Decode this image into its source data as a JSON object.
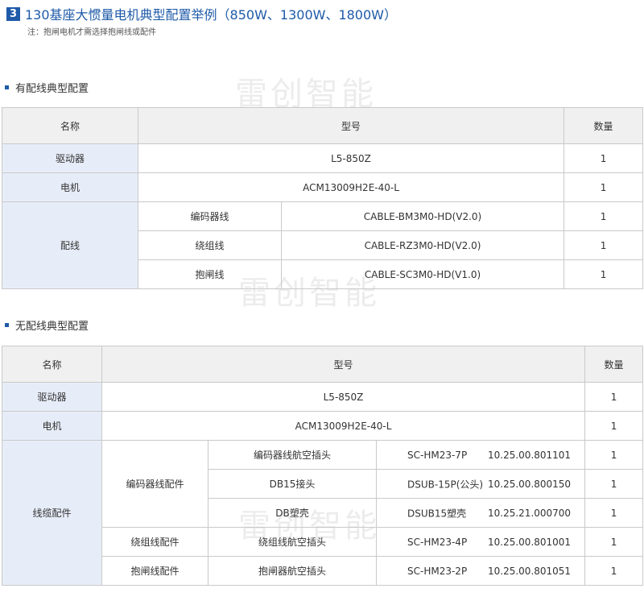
{
  "header": {
    "section_number": "3",
    "title": "130基座大惯量电机典型配置举例（850W、1300W、1800W）",
    "note": "注：抱闸电机才需选择抱闸线或配件"
  },
  "watermark": "雷创智能",
  "colors": {
    "accent": "#1e5aa8",
    "label_bg": "#e7edf8",
    "header_bg": "#f0f0f0",
    "border": "#c9c9c9"
  },
  "icons": {
    "section_marker": "square-bullet-icon"
  },
  "table1": {
    "heading": "有配线典型配置",
    "columns": {
      "name": "名称",
      "model": "型号",
      "qty": "数量"
    },
    "rows": {
      "driver": {
        "name": "驱动器",
        "model": "L5-850Z",
        "qty": "1"
      },
      "motor": {
        "name": "电机",
        "model": "ACM13009H2E-40-L",
        "qty": "1"
      }
    },
    "cables": {
      "label": "配线",
      "items": [
        {
          "name": "编码器线",
          "model": "CABLE-BM3M0-HD(V2.0)",
          "qty": "1"
        },
        {
          "name": "绕组线",
          "model": "CABLE-RZ3M0-HD(V2.0)",
          "qty": "1"
        },
        {
          "name": "抱闸线",
          "model": "CABLE-SC3M0-HD(V1.0)",
          "qty": "1"
        }
      ]
    }
  },
  "table2": {
    "heading": "无配线典型配置",
    "columns": {
      "name": "名称",
      "model": "型号",
      "qty": "数量"
    },
    "rows": {
      "driver": {
        "name": "驱动器",
        "model": "L5-850Z",
        "qty": "1"
      },
      "motor": {
        "name": "电机",
        "model": "ACM13009H2E-40-L",
        "qty": "1"
      }
    },
    "accessories": {
      "label": "线缆配件",
      "encoder_group": "编码器线配件",
      "encoder_items": [
        {
          "part": "编码器线航空插头",
          "code": "SC-HM23-7P",
          "pn": "10.25.00.801101",
          "qty": "1"
        },
        {
          "part": "DB15接头",
          "code": "DSUB-15P(公头)",
          "pn": "10.25.00.800150",
          "qty": "1"
        },
        {
          "part": "DB塑壳",
          "code": "DSUB15塑壳",
          "pn": "10.25.21.000700",
          "qty": "1"
        }
      ],
      "winding_group": "绕组线配件",
      "winding_item": {
        "part": "绕组线航空插头",
        "code": "SC-HM23-4P",
        "pn": "10.25.00.801001",
        "qty": "1"
      },
      "brake_group": "抱闸线配件",
      "brake_item": {
        "part": "抱闸器航空插头",
        "code": "SC-HM23-2P",
        "pn": "10.25.00.801051",
        "qty": "1"
      }
    }
  }
}
